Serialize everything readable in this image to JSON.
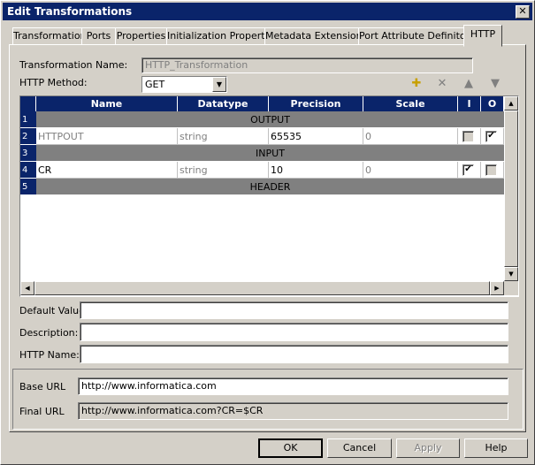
{
  "window": {
    "title": "Edit Transformations",
    "close_glyph": "✕"
  },
  "tabs": [
    {
      "label": "Transformation"
    },
    {
      "label": "Ports"
    },
    {
      "label": "Properties"
    },
    {
      "label": "Initialization Properties"
    },
    {
      "label": "Metadata Extensions"
    },
    {
      "label": "Port Attribute Definitons"
    },
    {
      "label": "HTTP"
    }
  ],
  "form": {
    "transformation_name_label": "Transformation Name:",
    "transformation_name_value": "HTTP_Transformation",
    "http_method_label": "HTTP Method:",
    "http_method_value": "GET"
  },
  "toolbar_icons": [
    "new-port-icon",
    "delete-icon",
    "move-up-icon",
    "move-down-icon"
  ],
  "grid": {
    "columns": [
      "Name",
      "Datatype",
      "Precision",
      "Scale",
      "I",
      "O"
    ],
    "rows": [
      {
        "num": "1",
        "group": "OUTPUT"
      },
      {
        "num": "2",
        "name": "HTTPOUT",
        "datatype": "string",
        "precision": "65535",
        "scale": "0",
        "i": false,
        "o": true
      },
      {
        "num": "3",
        "group": "INPUT"
      },
      {
        "num": "4",
        "name": "CR",
        "datatype": "string",
        "precision": "10",
        "scale": "0",
        "i": true,
        "o": false
      },
      {
        "num": "5",
        "group": "HEADER"
      }
    ]
  },
  "fields": {
    "default_value_label": "Default Value:",
    "default_value": "",
    "description_label": "Description:",
    "description": "",
    "http_name_label": "HTTP Name:",
    "http_name": "",
    "base_url_label": "Base URL",
    "base_url": "http://www.informatica.com",
    "final_url_label": "Final URL",
    "final_url": "http://www.informatica.com?CR=$CR"
  },
  "buttons": {
    "ok": "OK",
    "cancel": "Cancel",
    "apply": "Apply",
    "help": "Help"
  }
}
